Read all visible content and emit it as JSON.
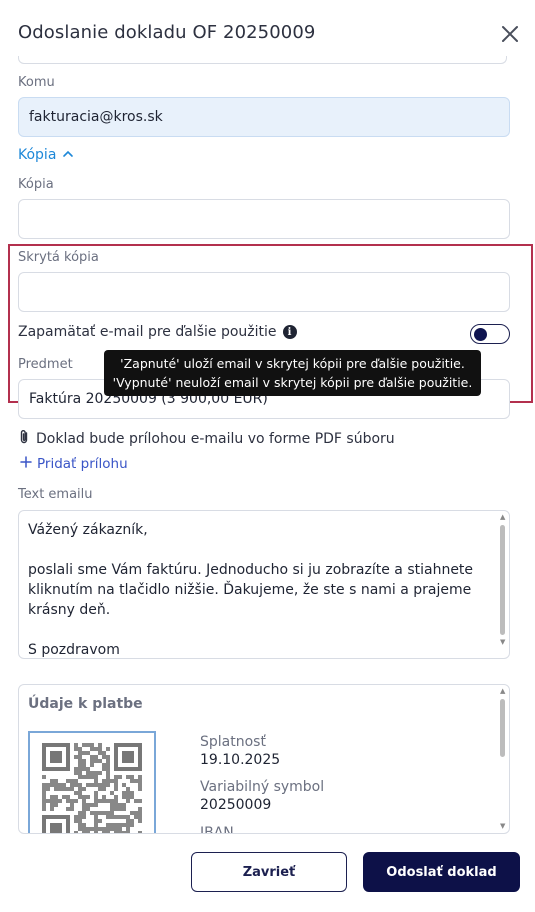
{
  "dialog": {
    "title": "Odoslanie dokladu OF 20250009"
  },
  "form": {
    "to_label": "Komu",
    "to_value": "fakturacia@kros.sk",
    "copy_toggle_label": "Kópia",
    "cc_label": "Kópia",
    "cc_value": "",
    "bcc_label": "Skrytá kópia",
    "bcc_value": "",
    "remember_label": "Zapamätať e-mail pre ďalšie použitie",
    "remember_enabled": false,
    "subject_label": "Predmet",
    "subject_value": "Faktúra 20250009 (3 900,00 EUR)",
    "attachment_note": "Doklad bude prílohou e-mailu vo forme PDF súboru",
    "add_attachment_label": "Pridať prílohu",
    "body_label": "Text emailu",
    "body_lines": [
      "Vážený zákazník,",
      "",
      "poslali sme Vám faktúru. Jednoducho si ju zobrazíte a stiahnete kliknutím na tlačidlo nižšie. Ďakujeme, že ste s nami a prajeme krásny deň.",
      "",
      "S pozdravom"
    ]
  },
  "tooltip": {
    "line1": "'Zapnuté' uloží email v skrytej kópii pre ďalšie použitie.",
    "line2": "'Vypnuté' neuloží email v skrytej kópii pre ďalšie použitie."
  },
  "payment": {
    "title": "Údaje k platbe",
    "due_label": "Splatnosť",
    "due_value": "19.10.2025",
    "vs_label": "Variabilný symbol",
    "vs_value": "20250009",
    "iban_label": "IBAN"
  },
  "footer": {
    "close_label": "Zavrieť",
    "send_label": "Odoslať doklad"
  },
  "colors": {
    "accent_link": "#1e88d8",
    "primary_button": "#0d1148",
    "highlight_border": "#b3304e",
    "filled_input": "#e8f1fb"
  },
  "icons": [
    "close-icon",
    "chevron-up-icon",
    "info-icon",
    "paperclip-icon",
    "plus-icon",
    "qr-code-icon"
  ]
}
